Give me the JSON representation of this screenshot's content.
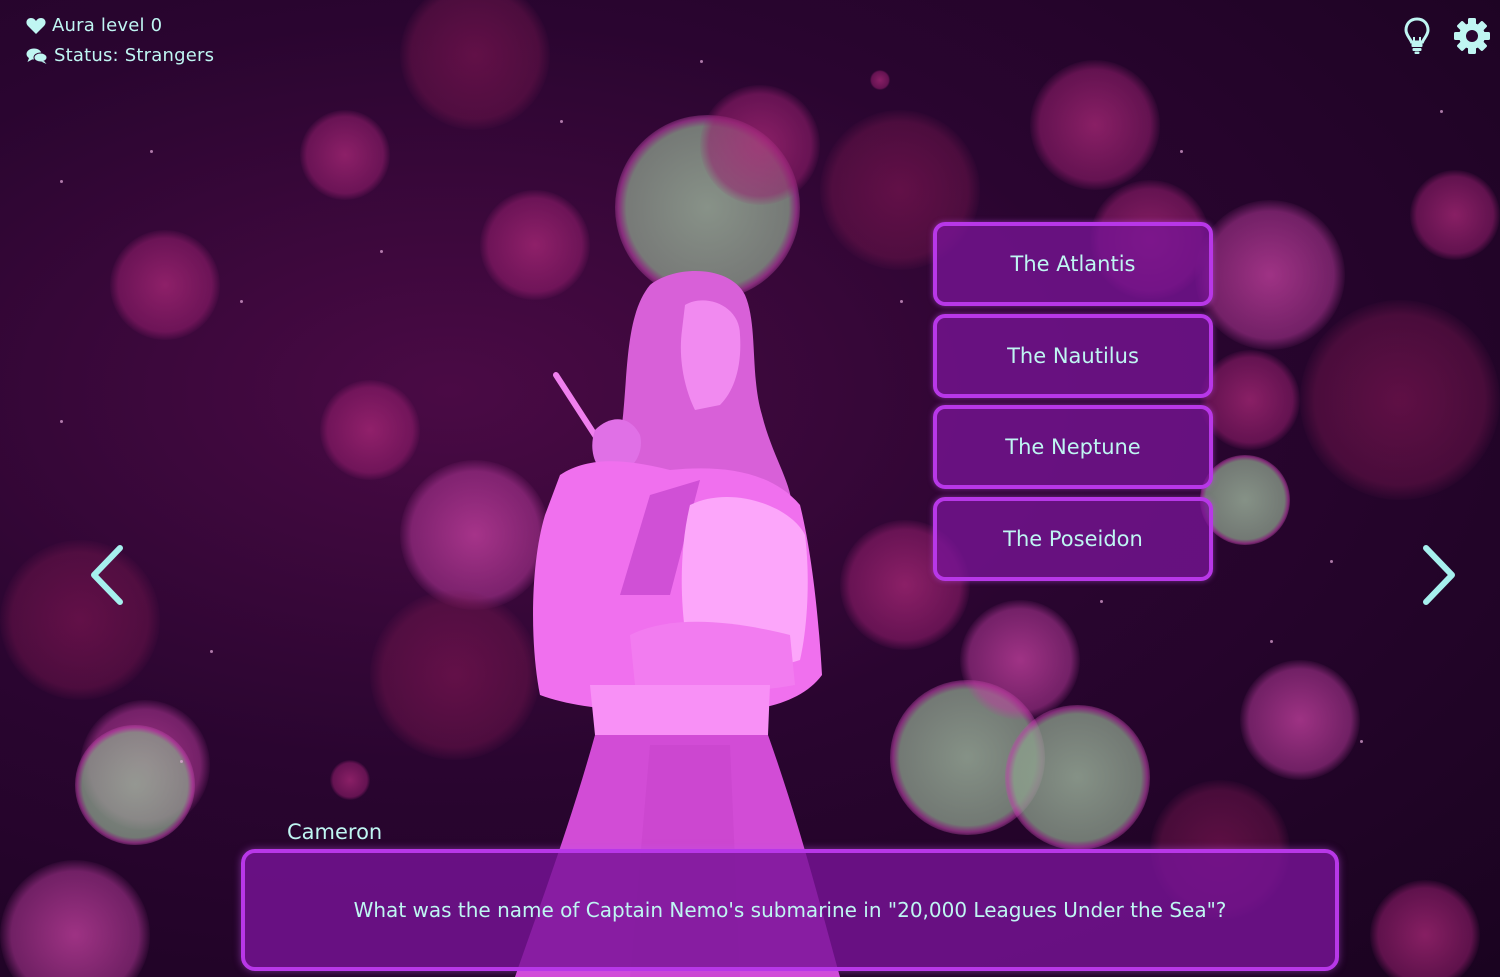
{
  "hud": {
    "aura_label": "Aura level 0",
    "status_label": "Status: Strangers",
    "aura_icon": "heart-icon",
    "status_icon": "chat-bubbles-icon"
  },
  "toolbar": {
    "hint_icon": "lightbulb-icon",
    "settings_icon": "gear-icon"
  },
  "choices": [
    {
      "label": "The Atlantis"
    },
    {
      "label": "The Nautilus"
    },
    {
      "label": "The Neptune"
    },
    {
      "label": "The Poseidon"
    }
  ],
  "navigation": {
    "prev_icon": "chevron-left-icon",
    "next_icon": "chevron-right-icon"
  },
  "dialogue": {
    "speaker": "Cameron",
    "text": "What was the name of Captain Nemo's submarine in \"20,000 Leagues Under the Sea\"?"
  },
  "colors": {
    "text_accent": "#bff6f2",
    "button_border": "#b837e8",
    "button_fill": "#7a1496",
    "character_fill": "#ee66e6",
    "background": "#2a0530"
  }
}
